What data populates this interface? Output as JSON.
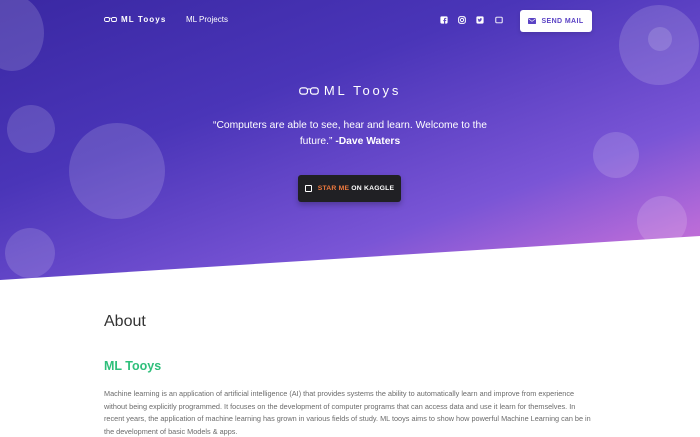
{
  "nav": {
    "brand": "ML Tooys",
    "link": "ML Projects",
    "social_icons": [
      "facebook-icon",
      "instagram-icon",
      "twitter-icon",
      "linkedin-icon"
    ],
    "send_mail_label": "SEND MAIL"
  },
  "hero": {
    "title": "ML Tooys",
    "quote": "“Computers are able to see, hear and learn. Welcome to the future.”",
    "author": "-Dave Waters",
    "cta_star": "STAR ME",
    "cta_rest": "ON KAGGLE"
  },
  "about": {
    "heading": "About",
    "subheading": "ML Tooys",
    "paragraph": "Machine learning is an application of artificial intelligence (AI) that provides systems the ability to automatically learn and improve from experience without being explicitly programmed. It focuses on the development of computer programs that can access data and use it learn for themselves. In recent years, the application of machine learning has grown in various fields of study. ML tooys aims to show how powerful Machine Learning can be in the development of basic Models & apps."
  },
  "colors": {
    "gradient_start": "#3a28a3",
    "gradient_end": "#d576d2",
    "accent_green": "#2fbf7b",
    "accent_orange": "#f07a3e",
    "button_dark": "#202024"
  }
}
